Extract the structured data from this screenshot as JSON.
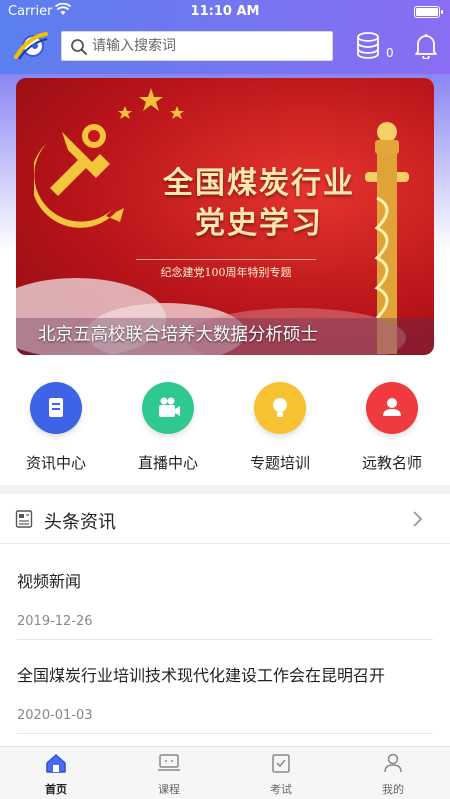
{
  "status_bar": {
    "carrier": "Carrier",
    "time": "11:10 AM"
  },
  "header": {
    "search_placeholder": "请输入搜索词",
    "coin_count": "0"
  },
  "banner": {
    "title_line1": "全国煤炭行业",
    "title_line2": "党史学习",
    "subtitle": "纪念建党100周年特别专题",
    "caption": "北京五高校联合培养大数据分析硕士"
  },
  "quick_links": [
    {
      "label": "资讯中心",
      "icon": "news-doc-icon",
      "color": "#3f63e6"
    },
    {
      "label": "直播中心",
      "icon": "video-camera-icon",
      "color": "#2fc98f"
    },
    {
      "label": "专题培训",
      "icon": "lightbulb-icon",
      "color": "#f6c232"
    },
    {
      "label": "远教名师",
      "icon": "teacher-icon",
      "color": "#ef3b40"
    }
  ],
  "news": {
    "title": "头条资讯",
    "items": [
      {
        "title": "视频新闻",
        "date": "2019-12-26"
      },
      {
        "title": "全国煤炭行业培训技术现代化建设工作会在昆明召开",
        "date": "2020-01-03"
      }
    ]
  },
  "tabbar": [
    {
      "label": "首页",
      "icon": "home-icon",
      "active": true
    },
    {
      "label": "课程",
      "icon": "course-icon",
      "active": false
    },
    {
      "label": "考试",
      "icon": "exam-icon",
      "active": false
    },
    {
      "label": "我的",
      "icon": "profile-icon",
      "active": false
    }
  ]
}
